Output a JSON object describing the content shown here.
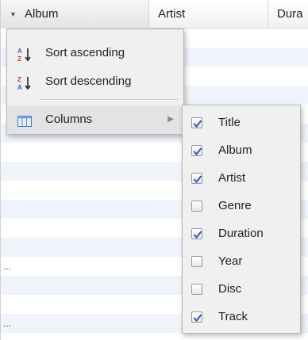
{
  "header": {
    "columns": [
      "Album",
      "Artist",
      "Dura"
    ]
  },
  "rows": {
    "ellipsis": "..."
  },
  "menu": {
    "items": [
      {
        "label": "Sort ascending",
        "icon": "sort-ascending-icon"
      },
      {
        "label": "Sort descending",
        "icon": "sort-descending-icon"
      },
      {
        "label": "Columns",
        "icon": "columns-icon"
      }
    ]
  },
  "columns_submenu": {
    "options": [
      {
        "label": "Title",
        "checked": true
      },
      {
        "label": "Album",
        "checked": true
      },
      {
        "label": "Artist",
        "checked": true
      },
      {
        "label": "Genre",
        "checked": false
      },
      {
        "label": "Duration",
        "checked": true
      },
      {
        "label": "Year",
        "checked": false
      },
      {
        "label": "Disc",
        "checked": false
      },
      {
        "label": "Track",
        "checked": true
      }
    ]
  },
  "colors": {
    "check": "#2a5bbd",
    "row_alt": "#eff4fa",
    "menu_bg": "#f0f0f0"
  }
}
